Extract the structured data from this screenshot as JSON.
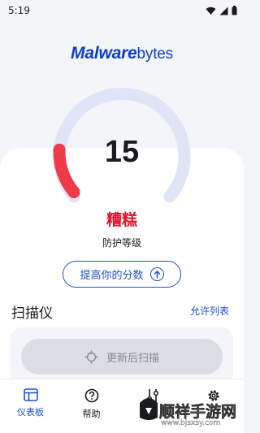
{
  "status_bar": {
    "time": "5:19"
  },
  "brand": {
    "logo_part1": "Malware",
    "logo_part2": "bytes",
    "accent_color": "#0d3ecc"
  },
  "protection": {
    "score": "15",
    "score_fraction": 0.15,
    "rating": "糟糕",
    "rating_color": "#e0142d",
    "level_label": "防护等级",
    "improve_button": "提高你的分数"
  },
  "scanner": {
    "title": "扫描仪",
    "allow_list": "允许列表",
    "scan_button": "更新后扫描"
  },
  "bottom_nav": {
    "items": [
      {
        "label": "仪表板",
        "icon": "dashboard-icon",
        "active": true
      },
      {
        "label": "帮助",
        "icon": "help-icon",
        "active": false
      },
      {
        "label": "",
        "icon": "tools-icon",
        "active": false
      },
      {
        "label": "",
        "icon": "settings-icon",
        "active": false
      }
    ]
  },
  "watermark": {
    "site_name": "顺祥手游网",
    "url": "www.bjsxsy.com"
  }
}
